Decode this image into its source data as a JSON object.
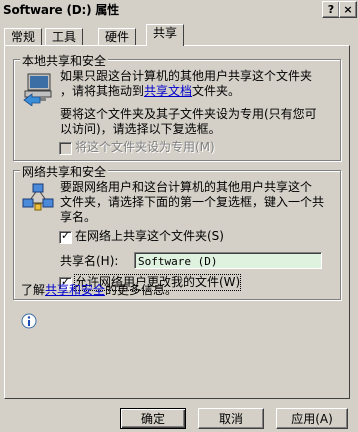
{
  "window": {
    "title": "Software (D:) 属性",
    "help_button": "?",
    "close_button": "×"
  },
  "tabs": [
    {
      "label": "常规"
    },
    {
      "label": "工具"
    },
    {
      "label": "硬件"
    },
    {
      "label": "共享",
      "active": true
    }
  ],
  "local_sharing": {
    "group_title": "本地共享和安全",
    "desc_line1": "如果只跟这台计算机的其他用户共享这个文件夹",
    "desc_line2_before": "，请将其拖动到",
    "desc_link": "共享文档",
    "desc_line2_after": "文件夹。",
    "private_line1": "要将这个文件夹及其子文件夹设为专用(只有您可",
    "private_line2": "以访问)，请选择以下复选框。",
    "make_private_label": "将这个文件夹设为专用(M)",
    "make_private_checked": false,
    "make_private_enabled": false
  },
  "network_sharing": {
    "group_title": "网络共享和安全",
    "desc_line1": "要跟网络用户和这台计算机的其他用户共享这个",
    "desc_line2": "文件夹，请选择下面的第一个复选框，键入一个共",
    "desc_line3": "享名。",
    "share_label": "在网络上共享这个文件夹(S)",
    "share_checked": true,
    "share_name_label": "共享名(H):",
    "share_name_value": "Software (D)",
    "allow_change_label": "允许网络用户更改我的文件(W)",
    "allow_change_checked": true,
    "learn_more_before": "了解",
    "learn_more_link": "共享和安全",
    "learn_more_after": "的更多信息。"
  },
  "buttons": {
    "ok": "确定",
    "cancel": "取消",
    "apply": "应用(A)"
  },
  "colors": {
    "dialog_bg": "#d4d0c8",
    "link": "#0000cc",
    "input_bg": "#dff1df"
  }
}
